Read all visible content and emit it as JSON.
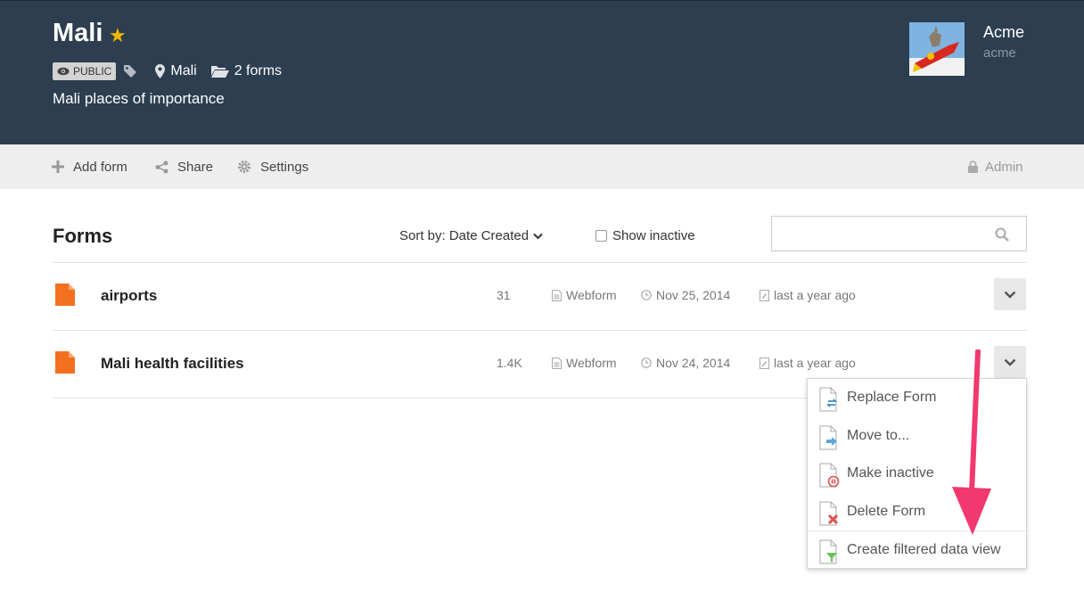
{
  "project": {
    "title": "Mali",
    "visibility": "PUBLIC",
    "location": "Mali",
    "forms_count": "2 forms",
    "description": "Mali places of importance"
  },
  "owner": {
    "name": "Acme",
    "username": "acme"
  },
  "toolbar": {
    "add_form": "Add form",
    "share": "Share",
    "settings": "Settings",
    "admin": "Admin"
  },
  "forms_section": {
    "title": "Forms",
    "sort_label": "Sort by: Date Created",
    "show_inactive_label": "Show inactive",
    "show_inactive_checked": false,
    "search_value": ""
  },
  "forms": [
    {
      "name": "airports",
      "count": "31",
      "type": "Webform",
      "created": "Nov 25, 2014",
      "modified": "last a year ago"
    },
    {
      "name": "Mali health facilities",
      "count": "1.4K",
      "type": "Webform",
      "created": "Nov 24, 2014",
      "modified": "last a year ago"
    }
  ],
  "form_menu": {
    "items": [
      {
        "label": "Replace Form",
        "icon": "replace-form-icon"
      },
      {
        "label": "Move to...",
        "icon": "move-form-icon"
      },
      {
        "label": "Make inactive",
        "icon": "make-inactive-icon"
      },
      {
        "label": "Delete Form",
        "icon": "delete-form-icon"
      },
      {
        "label": "Create filtered data view",
        "icon": "filter-view-icon"
      }
    ]
  },
  "colors": {
    "header_bg": "#2c3e50",
    "star": "#f5b800",
    "file_icon": "#f37021",
    "annotation_arrow": "#f2386e"
  }
}
